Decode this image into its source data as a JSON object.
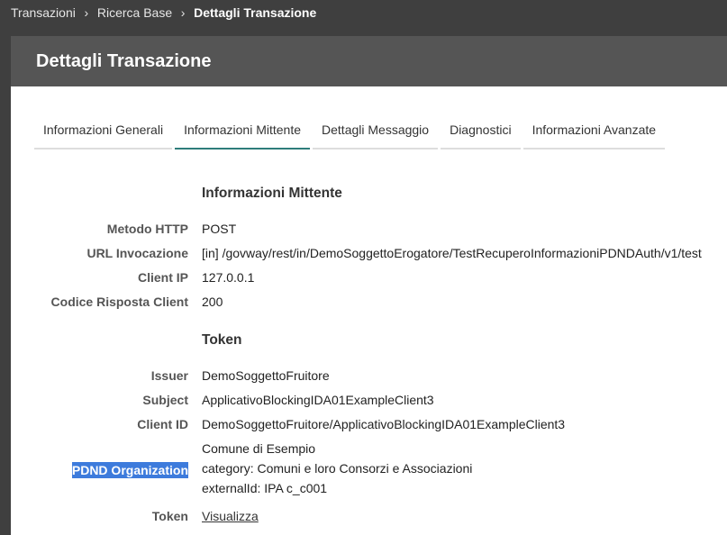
{
  "breadcrumb": {
    "items": [
      "Transazioni",
      "Ricerca Base"
    ],
    "current": "Dettagli Transazione",
    "separator": "›"
  },
  "header": {
    "title": "Dettagli Transazione"
  },
  "tabs": [
    {
      "label": "Informazioni Generali",
      "active": false
    },
    {
      "label": "Informazioni Mittente",
      "active": true
    },
    {
      "label": "Dettagli Messaggio",
      "active": false
    },
    {
      "label": "Diagnostici",
      "active": false
    },
    {
      "label": "Informazioni Avanzate",
      "active": false
    }
  ],
  "sender": {
    "title": "Informazioni Mittente",
    "fields": [
      {
        "label": "Metodo HTTP",
        "value": "POST"
      },
      {
        "label": "URL Invocazione",
        "value": "[in] /govway/rest/in/DemoSoggettoErogatore/TestRecuperoInformazioniPDNDAuth/v1/test"
      },
      {
        "label": "Client IP",
        "value": "127.0.0.1"
      },
      {
        "label": "Codice Risposta Client",
        "value": "200"
      }
    ]
  },
  "token": {
    "title": "Token",
    "issuer": {
      "label": "Issuer",
      "value": "DemoSoggettoFruitore"
    },
    "subject": {
      "label": "Subject",
      "value": "ApplicativoBlockingIDA01ExampleClient3"
    },
    "client_id": {
      "label": "Client ID",
      "value": "DemoSoggettoFruitore/ApplicativoBlockingIDA01ExampleClient3"
    },
    "pdnd": {
      "label": "PDND Organization",
      "lines": [
        "Comune di Esempio",
        "category: Comuni e loro Consorzi e Associazioni",
        "externalId: IPA c_c001"
      ]
    },
    "token": {
      "label": "Token",
      "link": "Visualizza"
    }
  },
  "colors": {
    "tab_active": "#2e7d7a",
    "highlight": "#3d7bdc",
    "header_bg": "#555555"
  }
}
